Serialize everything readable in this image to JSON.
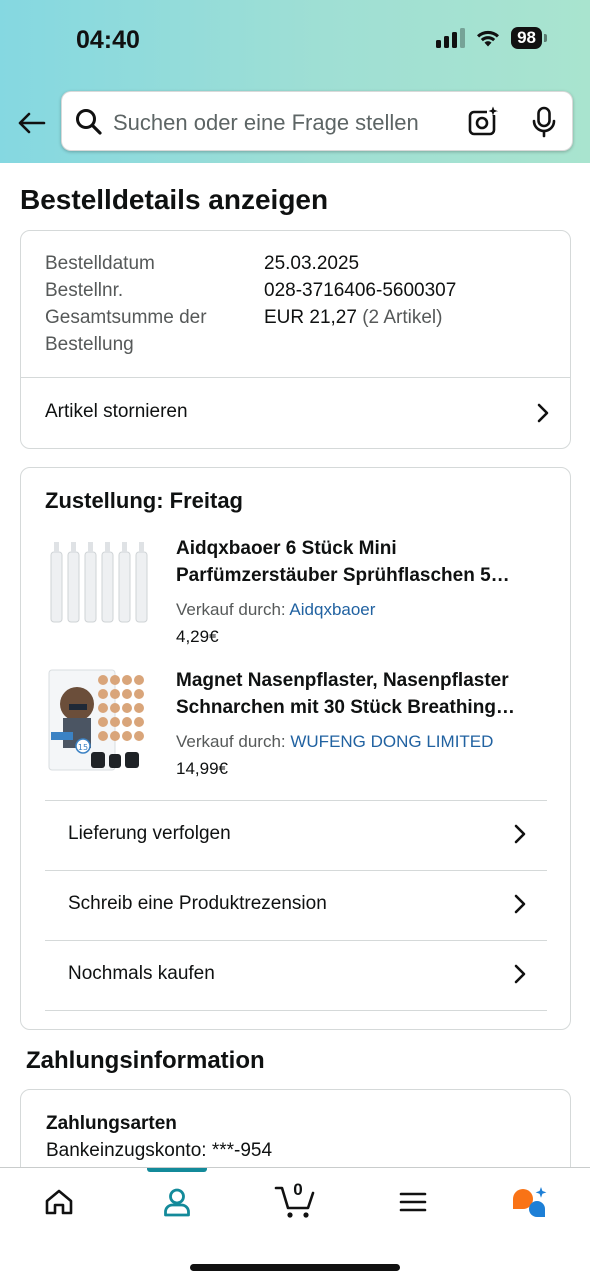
{
  "status_bar": {
    "time": "04:40",
    "battery": "98"
  },
  "search": {
    "placeholder": "Suchen oder eine Frage stellen"
  },
  "page_title": "Bestelldetails anzeigen",
  "order_summary": {
    "rows": [
      {
        "label": "Bestelldatum",
        "value": "25.03.2025"
      },
      {
        "label": "Bestellnr.",
        "value": "028-3716406-5600307"
      },
      {
        "label": "Gesamtsumme der Bestellung",
        "label_line1": "Gesamtsumme der",
        "label_line2": "Bestellung",
        "value": "EUR 21,27",
        "value_extra": "(2 Artikel)"
      }
    ],
    "cancel_label": "Artikel stornieren"
  },
  "delivery": {
    "heading": "Zustellung: Freitag",
    "items": [
      {
        "title_line1": "Aidqxbaoer 6 Stück Mini",
        "title_line2": "Parfümzerstäuber Sprühflaschen 5…",
        "seller_prefix": "Verkauf durch:",
        "seller": "Aidqxbaoer",
        "price": "4,29€"
      },
      {
        "title_line1": "Magnet Nasenpflaster, Nasenpflaster",
        "title_line2": "Schnarchen mit 30 Stück Breathing…",
        "seller_prefix": "Verkauf durch:",
        "seller": "WUFENG DONG LIMITED",
        "price": "14,99€",
        "thumb_badge": "15"
      }
    ],
    "actions": [
      {
        "label": "Lieferung verfolgen"
      },
      {
        "label": "Schreib eine Produktrezension"
      },
      {
        "label": "Nochmals kaufen"
      }
    ]
  },
  "payment": {
    "section_title": "Zahlungsinformation",
    "label": "Zahlungsarten",
    "value": "Bankeinzugskonto: ***-954"
  },
  "tabbar": {
    "cart_count": "0",
    "accent_color": "#138a9a"
  }
}
